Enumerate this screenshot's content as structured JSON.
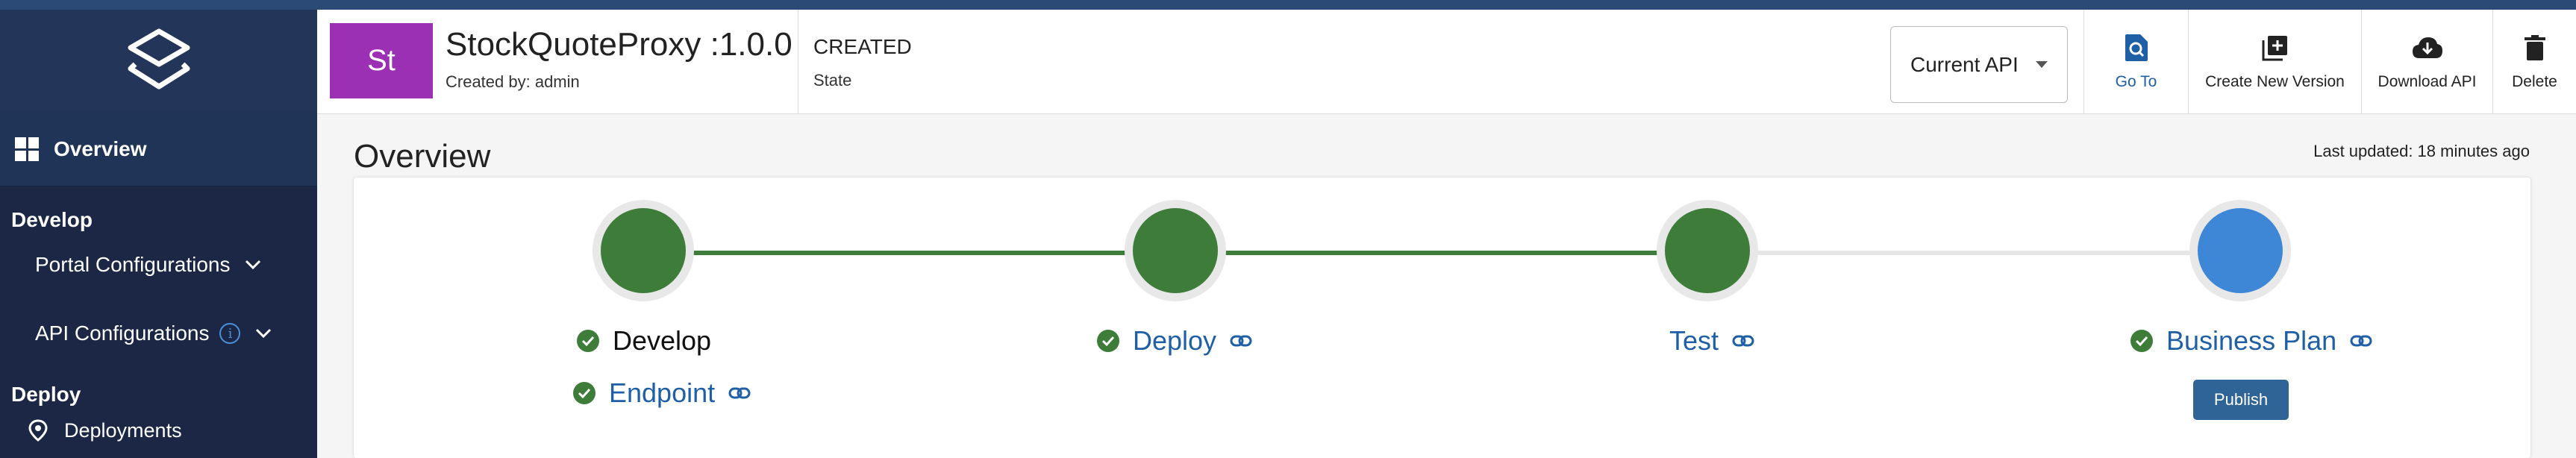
{
  "sidebar": {
    "logo_icon": "layers-logo-icon",
    "overview_label": "Overview",
    "develop_title": "Develop",
    "portal_config_label": "Portal Configurations",
    "api_config_label": "API Configurations",
    "info_glyph": "i",
    "deploy_title": "Deploy",
    "deployments_label": "Deployments"
  },
  "header": {
    "avatar_initials": "St",
    "api_name": "StockQuoteProxy :1.0.0",
    "created_by": "Created by: admin",
    "state_value": "CREATED",
    "state_label": "State",
    "version_select": "Current API",
    "goto_label": "Go To",
    "new_version_label": "Create New Version",
    "download_label": "Download API",
    "delete_label": "Delete"
  },
  "main": {
    "title": "Overview",
    "last_updated": "Last updated: 18 minutes ago"
  },
  "lifecycle": {
    "complete_color": "#3e7c3a",
    "current_color": "#3d87d6",
    "pending_line_color": "#e6e6e6",
    "stages": [
      {
        "label": "Develop",
        "status": "complete"
      },
      {
        "label": "Endpoint",
        "status": "complete"
      },
      {
        "label": "Deploy",
        "status": "complete"
      },
      {
        "label": "Test",
        "status": "complete"
      },
      {
        "label": "Business Plan",
        "status": "current"
      }
    ],
    "publish_label": "Publish"
  }
}
